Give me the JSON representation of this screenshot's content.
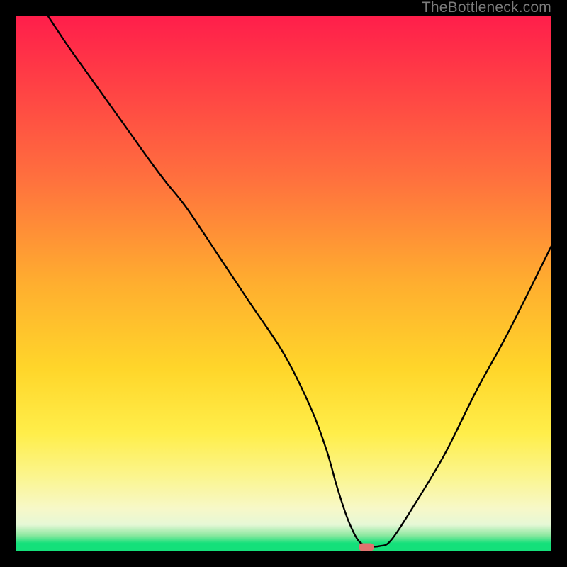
{
  "watermark": "TheBottleneck.com",
  "marker": {
    "x_pct": 65.5,
    "y_pct": 99.2,
    "color": "#e0726f"
  },
  "axes": {
    "x_range_pct": [
      0,
      100
    ],
    "y_range_pct": [
      0,
      100
    ],
    "grid": false
  },
  "gradient_stops": [
    {
      "pct": 0,
      "color": "#ff1e4b"
    },
    {
      "pct": 8,
      "color": "#ff3347"
    },
    {
      "pct": 30,
      "color": "#ff6f3e"
    },
    {
      "pct": 50,
      "color": "#ffae2f"
    },
    {
      "pct": 66,
      "color": "#ffd62a"
    },
    {
      "pct": 78,
      "color": "#ffee4a"
    },
    {
      "pct": 86,
      "color": "#fbf58e"
    },
    {
      "pct": 92,
      "color": "#f7f8c8"
    },
    {
      "pct": 95,
      "color": "#e6f8d6"
    },
    {
      "pct": 97,
      "color": "#8ce8a0"
    },
    {
      "pct": 98.5,
      "color": "#14e07a"
    },
    {
      "pct": 100,
      "color": "#14e07a"
    }
  ],
  "chart_data": {
    "type": "line",
    "title": "",
    "xlabel": "",
    "ylabel": "",
    "xlim": [
      0,
      100
    ],
    "ylim": [
      0,
      100
    ],
    "series": [
      {
        "name": "bottleneck-curve",
        "color": "#000000",
        "x": [
          6,
          10,
          15,
          20,
          25,
          28,
          32,
          38,
          44,
          50,
          55,
          58,
          60,
          62,
          64,
          66,
          68,
          70,
          74,
          80,
          86,
          92,
          100
        ],
        "y": [
          100,
          94,
          87,
          80,
          73,
          69,
          64,
          55,
          46,
          37,
          27,
          19,
          12,
          6,
          2,
          1,
          1,
          2,
          8,
          18,
          30,
          41,
          57
        ]
      }
    ],
    "annotations": [
      {
        "type": "marker",
        "shape": "pill",
        "x": 65.5,
        "y": 0.8,
        "color": "#e0726f"
      }
    ]
  }
}
